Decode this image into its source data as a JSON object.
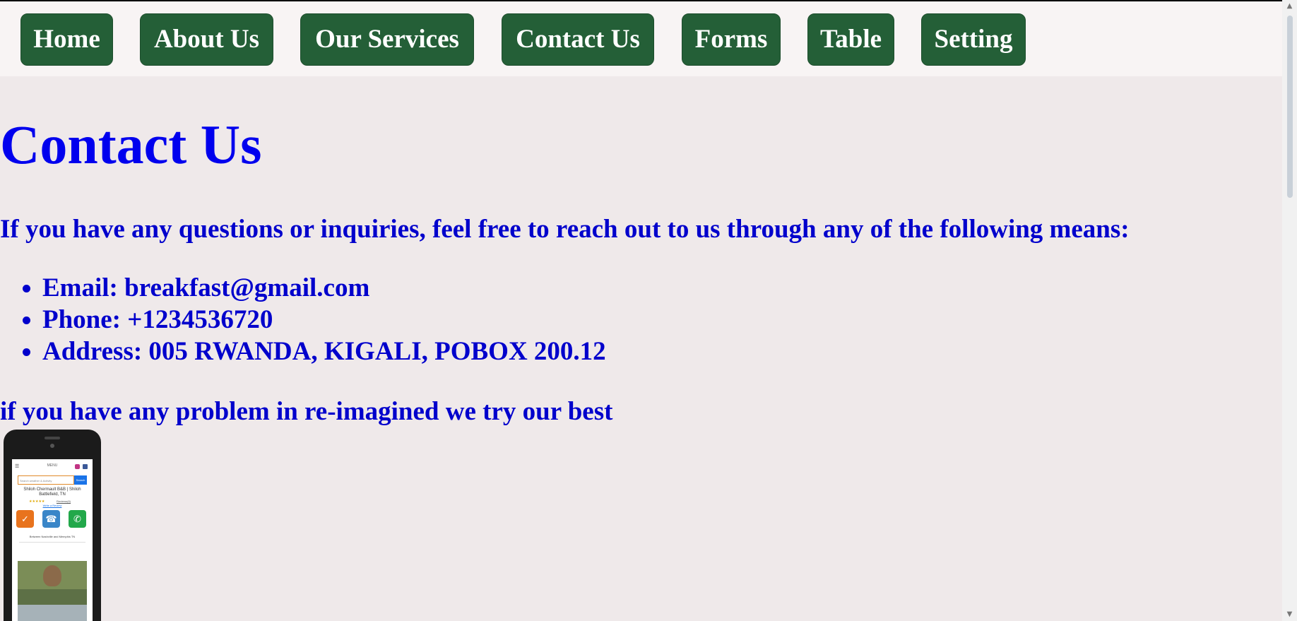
{
  "nav": {
    "home": "Home",
    "about": "About Us",
    "services": "Our Services",
    "contact": "Contact Us",
    "forms": "Forms",
    "table": "Table",
    "setting": "Setting"
  },
  "main": {
    "title": "Contact Us",
    "intro": "If you have any questions or inquiries, feel free to reach out to us through any of the following means:",
    "contacts": [
      "Email: breakfast@gmail.com",
      "Phone: +1234536720",
      "Address: 005 RWANDA, KIGALI, POBOX 200.12"
    ],
    "outro": "if you have any problem in re-imagined we try our best"
  },
  "phone_mockup": {
    "site_label": "MENU",
    "search_placeholder": "Search weather & Activity",
    "search_button": "Search",
    "listing_title": "Shiloh Chermault B&B | Shiloh Battlefield, TN",
    "review_text": "Reviews(6)",
    "review_link": "Write a Review",
    "address_line": "Between Nashville and Memphis TN"
  },
  "colors": {
    "nav_button": "#245f37",
    "text_blue": "#0000cc",
    "background": "#efe9ea"
  }
}
